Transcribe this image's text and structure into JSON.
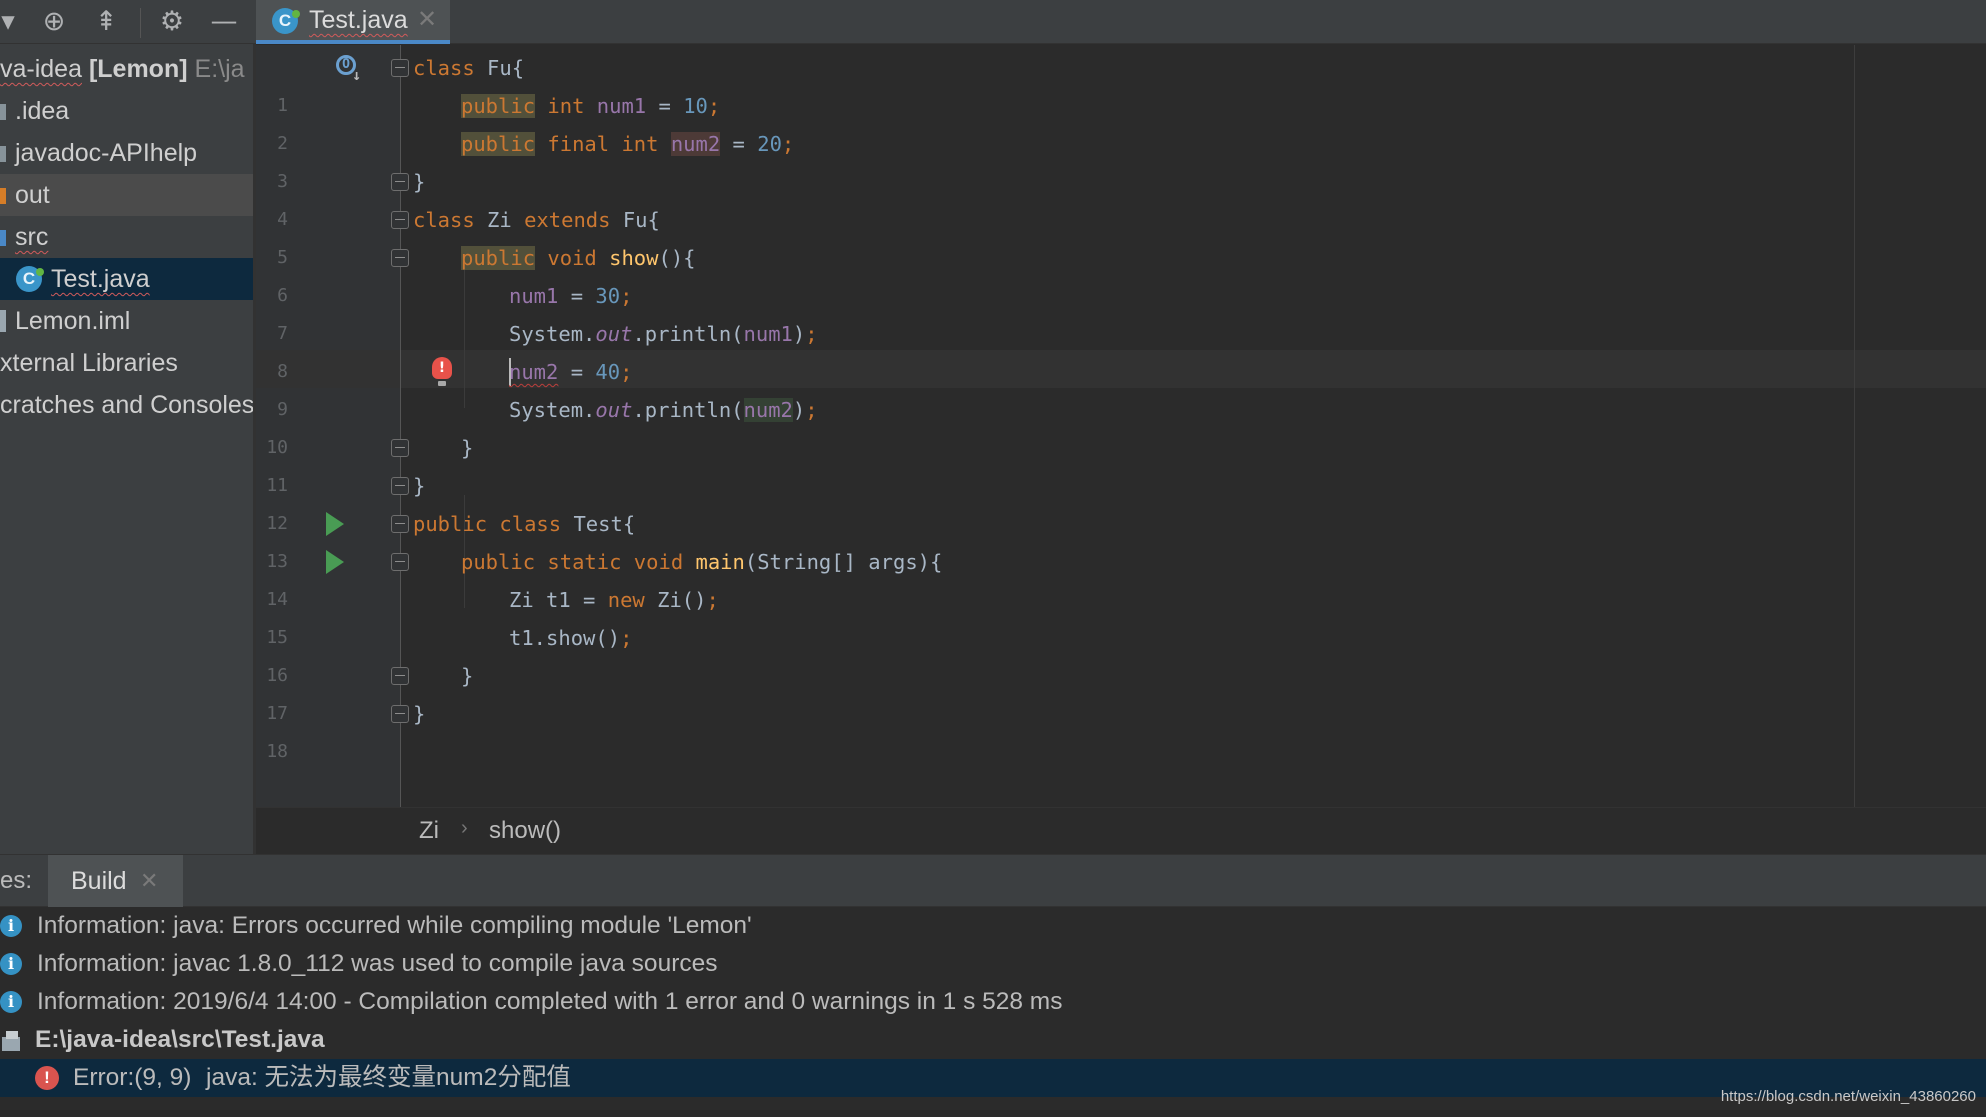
{
  "toolbar": {
    "icons": [
      "dropdown-arrow-icon",
      "locate-icon",
      "collapse-all-icon",
      "gear-icon",
      "hide-icon"
    ]
  },
  "editor_tab": {
    "label": "Test.java",
    "icon_letter": "C",
    "close": "✕"
  },
  "project": {
    "root_name": "va-idea",
    "root_module": "[Lemon]",
    "root_path": "E:\\ja",
    "items": [
      {
        "label": ".idea"
      },
      {
        "label": "javadoc-APIhelp"
      },
      {
        "label": "out"
      },
      {
        "label": "src"
      },
      {
        "label": "Test.java",
        "icon_letter": "C"
      },
      {
        "label": "Lemon.iml"
      },
      {
        "label": "xternal Libraries"
      },
      {
        "label": "cratches and Consoles"
      }
    ]
  },
  "code": {
    "line_numbers": [
      "1",
      "2",
      "3",
      "4",
      "5",
      "6",
      "7",
      "8",
      "9",
      "10",
      "11",
      "12",
      "13",
      "14",
      "15",
      "16",
      "17",
      "18"
    ],
    "l1": {
      "kw": "class",
      "rest": " Fu{"
    },
    "l2": {
      "kw1": "public",
      "kw2": " int ",
      "field": "num1",
      "op": " = ",
      "num": "10",
      "semi": ";"
    },
    "l3": {
      "kw1": "public",
      "kw2": " final int ",
      "field": "num2",
      "op": " = ",
      "num": "20",
      "semi": ";"
    },
    "l4": {
      "rest": "}"
    },
    "l5": {
      "kw": "class",
      "mid": " Zi ",
      "kw2": "extends",
      "rest": " Fu{"
    },
    "l6": {
      "kw1": "public",
      "kw2": " void ",
      "method": "show",
      "rest": "(){"
    },
    "l7": {
      "field": "num1",
      "op": " = ",
      "num": "30",
      "semi": ";"
    },
    "l8": {
      "cls": "System.",
      "out": "out",
      "call": ".println(",
      "arg": "num1",
      "close": ")",
      "semi": ";"
    },
    "l9": {
      "field": "num2",
      "op": " = ",
      "num": "40",
      "semi": ";"
    },
    "l10": {
      "cls": "System.",
      "out": "out",
      "call": ".println(",
      "arg": "num2",
      "close": ")",
      "semi": ";"
    },
    "l11": {
      "rest": "}"
    },
    "l12": {
      "rest": "}"
    },
    "l13": {
      "kw": "public class",
      "rest": " Test{"
    },
    "l14": {
      "kw": "public static void ",
      "method": "main",
      "rest": "(String[] args){"
    },
    "l15": {
      "pre": "Zi t1 = ",
      "kw": "new",
      "post": " Zi()",
      "semi": ";"
    },
    "l16": {
      "pre": "t1.show()",
      "semi": ";"
    },
    "l17": {
      "rest": "}"
    },
    "l18": {
      "rest": "}"
    },
    "bulb_glyph": "!",
    "override_glyph": "O"
  },
  "breadcrumb": {
    "items": [
      "Zi",
      "show()"
    ],
    "separator": "›"
  },
  "build_panel": {
    "prefix": "es:",
    "tab_label": "Build",
    "tab_close": "✕",
    "messages": [
      {
        "icon": "info-icon",
        "text": "Information: java: Errors occurred while compiling module 'Lemon'"
      },
      {
        "icon": "info-icon",
        "text": "Information: javac 1.8.0_112 was used to compile java sources"
      },
      {
        "icon": "info-icon",
        "text": "Information: 2019/6/4 14:00 - Compilation completed with 1 error and 0 warnings in 1 s 528 ms"
      }
    ],
    "file_path": "E:\\java-idea\\src\\Test.java",
    "error": {
      "location": "Error:(9, 9)",
      "message": "java: 无法为最终变量num2分配值"
    },
    "info_glyph": "i",
    "error_glyph": "!"
  },
  "watermark": "https://blog.csdn.net/weixin_43860260",
  "colors": {
    "keyword": "#cc7832",
    "field": "#9876aa",
    "number": "#6897bb",
    "method": "#ffc66d",
    "text": "#a9b7c6",
    "selection": "#0d293e",
    "tab_accent": "#4a88c7"
  }
}
